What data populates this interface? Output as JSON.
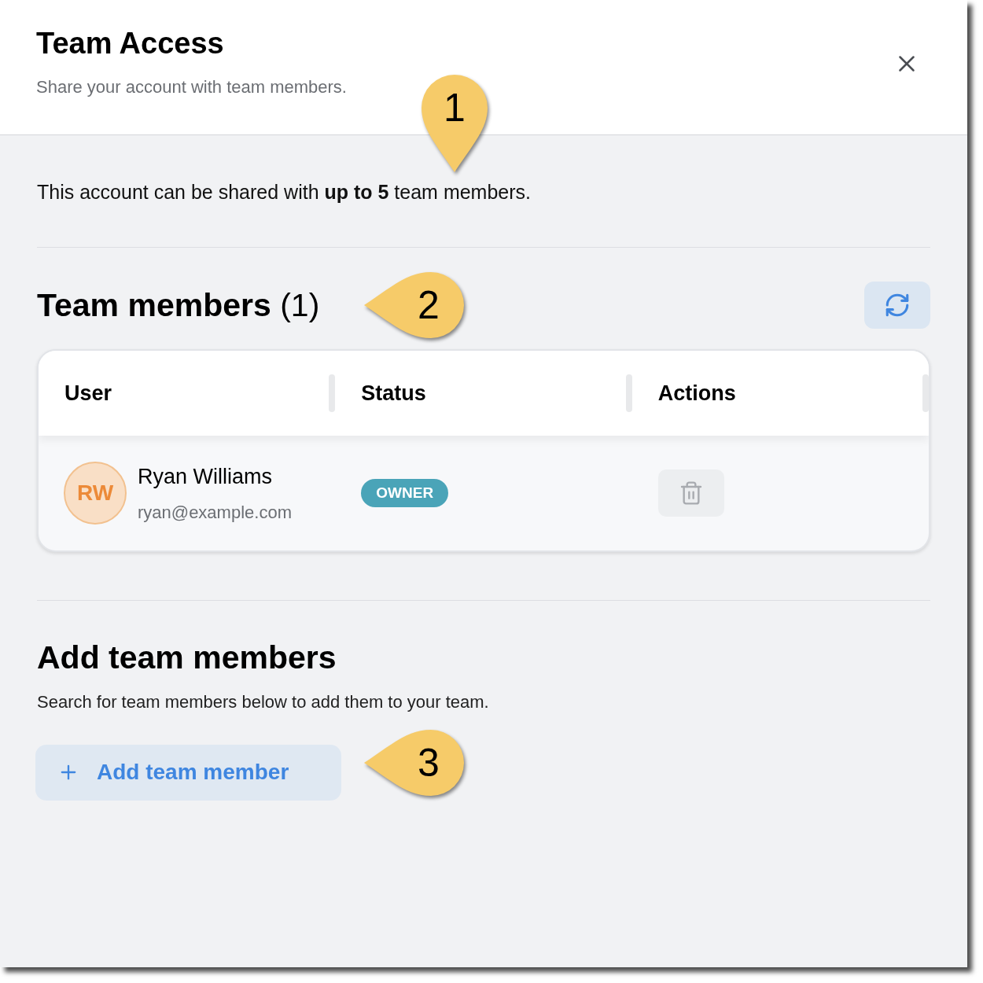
{
  "header": {
    "title": "Team Access",
    "subtitle": "Share your account with team members."
  },
  "intro": "This account can be shared with **up to 5** team members.",
  "members_section": {
    "title": "Team members",
    "count": "(1)"
  },
  "table": {
    "columns": [
      "User",
      "Status",
      "Actions"
    ],
    "rows": [
      {
        "initials": "RW",
        "name": "Ryan Williams",
        "email": "ryan@example.com",
        "status": "OWNER"
      }
    ]
  },
  "add_section": {
    "title": "Add team members",
    "description": "Search for team members below to add them to your team.",
    "button": "Add team member"
  },
  "callouts": [
    {
      "number": "1",
      "kind": "down"
    },
    {
      "number": "2",
      "kind": "left"
    },
    {
      "number": "3",
      "kind": "left"
    }
  ]
}
